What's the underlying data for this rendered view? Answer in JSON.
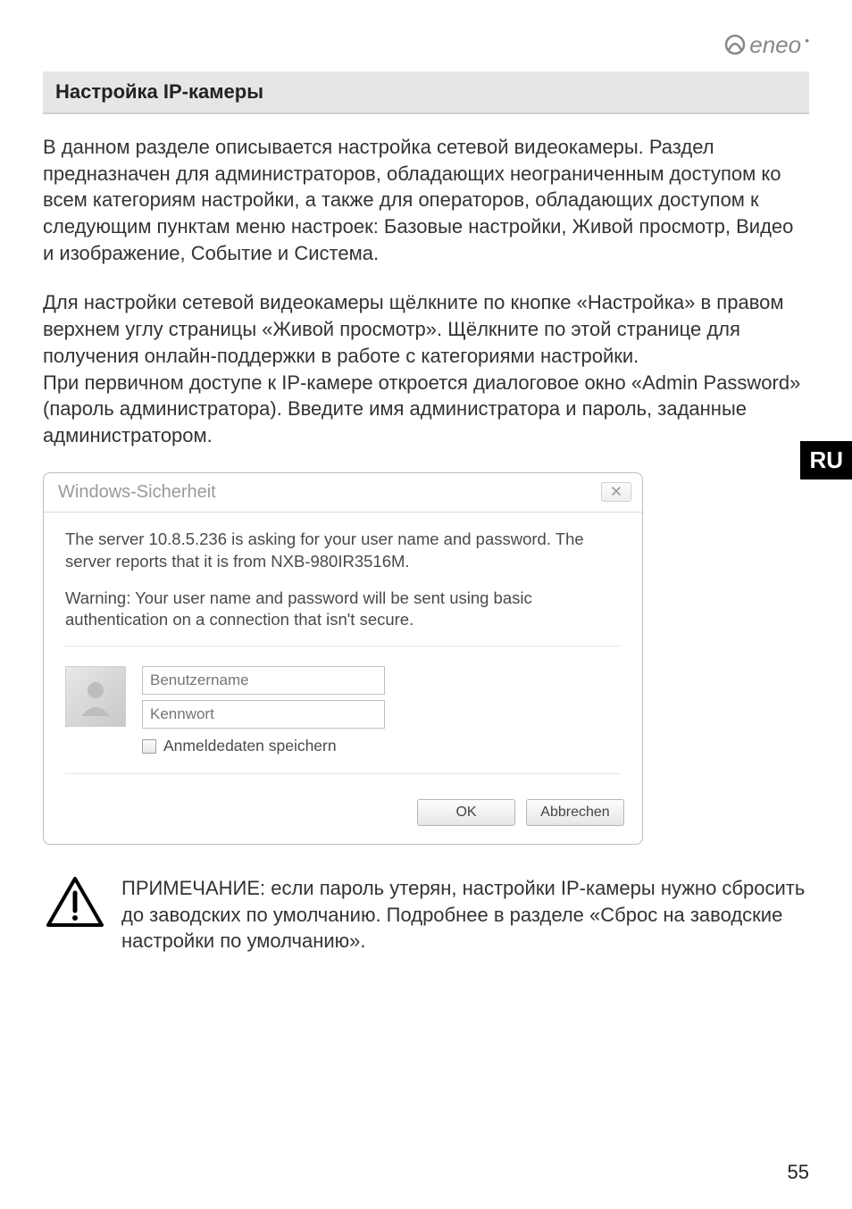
{
  "logo": {
    "text": "eneo"
  },
  "section_title": "Настройка IP-камеры",
  "paragraph_1": "В данном разделе описывается настройка сетевой видеокамеры. Раздел предназначен для администраторов, обладающих неограниченным доступом ко всем категориям настройки, а также для операторов, обладающих доступом к следующим пунктам меню настроек: Базовые настройки, Живой просмотр, Видео и изображение, Событие и Система.",
  "paragraph_2": "Для настройки сетевой видеокамеры щёлкните по кнопке «Настройка» в правом верхнем углу страницы «Живой просмотр». Щёлкните по этой странице для получения онлайн-поддержки в работе с категориями настройки.\nПри первичном доступе к IP-камере откроется диалоговое окно «Admin Password» (пароль администратора). Введите имя администратора и пароль, заданные администратором.",
  "lang_tab": "RU",
  "dialog": {
    "title": "Windows-Sicherheit",
    "msg_1": "The server 10.8.5.236 is asking for your user name and password. The server reports that it is from NXB-980IR3516M.",
    "msg_2": "Warning: Your user name and password will be sent using basic authentication on a connection that isn't secure.",
    "username_placeholder": "Benutzername",
    "password_placeholder": "Kennwort",
    "remember_label": "Anmeldedaten speichern",
    "ok_label": "OK",
    "cancel_label": "Abbrechen"
  },
  "note": "ПРИМЕЧАНИЕ: если пароль утерян, настройки IP-камеры нужно сбросить до заводских по умолчанию. Подробнее в разделе «Сброс на заводские настройки по умолчанию».",
  "page_number": "55"
}
